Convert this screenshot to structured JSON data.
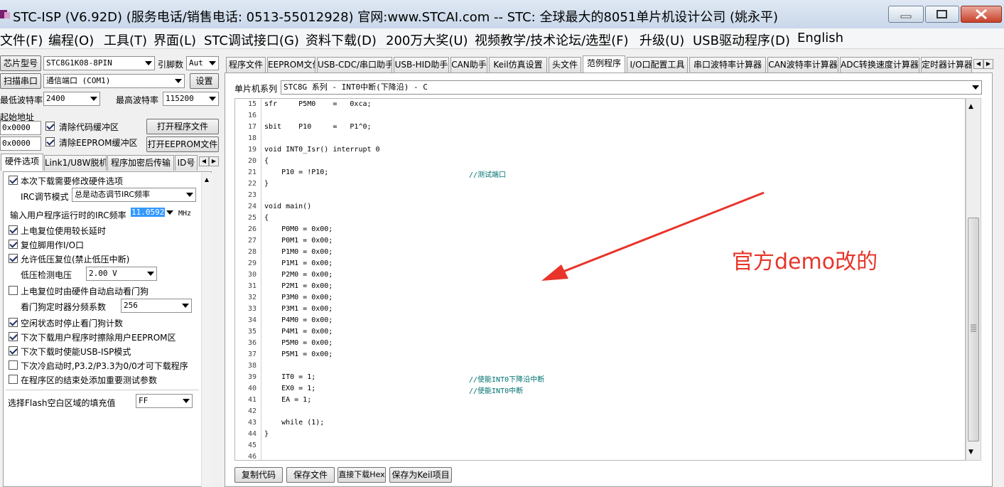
{
  "window": {
    "title": "STC-ISP (V6.92D) (服务电话/销售电话: 0513-55012928) 官网:www.STCAI.com  -- STC: 全球最大的8051单片机设计公司 (姚永平)"
  },
  "menu": [
    "文件(F)",
    "编程(O)",
    "工具(T)",
    "界面(L)",
    "STC调试接口(G)",
    "资料下载(D)",
    "200万大奖(U)",
    "视频教学/技术论坛/选型(F)",
    "升级(U)",
    "USB驱动程序(D)",
    "English"
  ],
  "left": {
    "chip_label": "芯片型号",
    "chip_value": "STC8G1K08-8PIN",
    "pins_label": "引脚数",
    "pins_value": "Aut",
    "scan_button": "扫描串口",
    "port_value": "通信端口 (COM1)",
    "settings_button": "设置",
    "min_baud_label": "最低波特率",
    "min_baud_value": "2400",
    "max_baud_label": "最高波特率",
    "max_baud_value": "115200",
    "start_addr_label": "起始地址",
    "addr1": "0x0000",
    "clear_code_label": "清除代码缓冲区",
    "open_prog_button": "打开程序文件",
    "addr2": "0x0000",
    "clear_eeprom_label": "清除EEPROM缓冲区",
    "open_eeprom_button": "打开EEPROM文件",
    "tabs": [
      "硬件选项",
      "Link1/U8W脱机",
      "程序加密后传输",
      "ID号"
    ],
    "opt_modify_hw": "本次下载需要修改硬件选项",
    "irc_mode_label": "IRC调节模式",
    "irc_mode_value": "总是动态调节IRC频率",
    "irc_freq_label": "输入用户程序运行时的IRC频率",
    "irc_freq_value": "11.0592",
    "irc_unit": "MHz",
    "opt_long_delay": "上电复位使用较长延时",
    "opt_reset_io": "复位脚用作I/O口",
    "opt_lvd_reset": "允许低压复位(禁止低压中断)",
    "lvd_label": "低压检测电压",
    "lvd_value": "2.00 V",
    "opt_wdt_hw": "上电复位时由硬件自动启动看门狗",
    "wdt_div_label": "看门狗定时器分频系数",
    "wdt_div_value": "256",
    "opt_idle_wdt": "空闲状态时停止看门狗计数",
    "opt_erase_eeprom": "下次下载用户程序时擦除用户EEPROM区",
    "opt_usb_isp": "下次下载时使能USB-ISP模式",
    "opt_cold_boot": "下次冷启动时,P3.2/P3.3为0/0才可下载程序",
    "opt_add_params": "在程序区的结束处添加重要测试参数",
    "flash_fill_label": "选择Flash空白区域的填充值",
    "flash_fill_value": "FF"
  },
  "right": {
    "tabs": [
      "程序文件",
      "EEPROM文件",
      "USB-CDC/串口助手",
      "USB-HID助手",
      "CAN助手",
      "Keil仿真设置",
      "头文件",
      "范例程序",
      "I/O口配置工具",
      "串口波特率计算器",
      "CAN波特率计算器",
      "ADC转换速度计算器",
      "定时器计算器"
    ],
    "series_label": "单片机系列",
    "series_value": "STC8G 系列 - INT0中断(下降沿) - C",
    "code_lines": [
      {
        "n": "15",
        "code": "sfr     P5M0    =   0xca;",
        "cmt": ""
      },
      {
        "n": "16",
        "code": "",
        "cmt": ""
      },
      {
        "n": "17",
        "code": "sbit    P10     =   P1^0;",
        "cmt": ""
      },
      {
        "n": "18",
        "code": "",
        "cmt": ""
      },
      {
        "n": "19",
        "code": "void INT0_Isr() interrupt 0",
        "cmt": ""
      },
      {
        "n": "20",
        "code": "{",
        "cmt": ""
      },
      {
        "n": "21",
        "code": "    P10 = !P10;",
        "cmt": "//测试端口"
      },
      {
        "n": "22",
        "code": "}",
        "cmt": ""
      },
      {
        "n": "23",
        "code": "",
        "cmt": ""
      },
      {
        "n": "24",
        "code": "void main()",
        "cmt": ""
      },
      {
        "n": "25",
        "code": "{",
        "cmt": ""
      },
      {
        "n": "26",
        "code": "    P0M0 = 0x00;",
        "cmt": ""
      },
      {
        "n": "27",
        "code": "    P0M1 = 0x00;",
        "cmt": ""
      },
      {
        "n": "28",
        "code": "    P1M0 = 0x00;",
        "cmt": ""
      },
      {
        "n": "29",
        "code": "    P1M1 = 0x00;",
        "cmt": ""
      },
      {
        "n": "30",
        "code": "    P2M0 = 0x00;",
        "cmt": ""
      },
      {
        "n": "31",
        "code": "    P2M1 = 0x00;",
        "cmt": ""
      },
      {
        "n": "32",
        "code": "    P3M0 = 0x00;",
        "cmt": ""
      },
      {
        "n": "33",
        "code": "    P3M1 = 0x00;",
        "cmt": ""
      },
      {
        "n": "34",
        "code": "    P4M0 = 0x00;",
        "cmt": ""
      },
      {
        "n": "35",
        "code": "    P4M1 = 0x00;",
        "cmt": ""
      },
      {
        "n": "36",
        "code": "    P5M0 = 0x00;",
        "cmt": ""
      },
      {
        "n": "37",
        "code": "    P5M1 = 0x00;",
        "cmt": ""
      },
      {
        "n": "38",
        "code": "",
        "cmt": ""
      },
      {
        "n": "39",
        "code": "    IT0 = 1;",
        "cmt": "//使能INT0下降沿中断"
      },
      {
        "n": "40",
        "code": "    EX0 = 1;",
        "cmt": "//使能INT0中断"
      },
      {
        "n": "41",
        "code": "    EA = 1;",
        "cmt": ""
      },
      {
        "n": "42",
        "code": "",
        "cmt": ""
      },
      {
        "n": "43",
        "code": "    while (1);",
        "cmt": ""
      },
      {
        "n": "44",
        "code": "}",
        "cmt": ""
      },
      {
        "n": "45",
        "code": "",
        "cmt": ""
      },
      {
        "n": "46",
        "code": "",
        "cmt": ""
      }
    ],
    "buttons": [
      "复制代码",
      "保存文件",
      "直接下载Hex",
      "保存为Keil项目"
    ],
    "annotation": "官方demo改的",
    "annotation_color": "#e8342a"
  }
}
